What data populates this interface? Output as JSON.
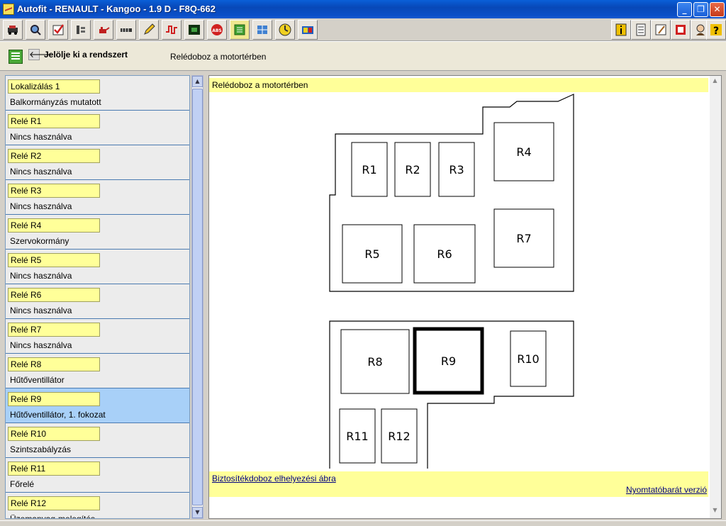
{
  "window": {
    "title": "Autofit - RENAULT - Kangoo - 1.9 D - F8Q-662",
    "controls": [
      "minimize",
      "restore",
      "close"
    ]
  },
  "toolbar": {
    "left_icons": [
      "vehicle-icon",
      "inspect-icon",
      "checklist-icon",
      "tools-icon",
      "oil-can-icon",
      "gauge-strip-icon",
      "pencil-icon",
      "signal-icon",
      "circuit-board-icon",
      "abs-icon",
      "relay-box-icon",
      "diagram-icon",
      "timer-icon",
      "battery-icon"
    ],
    "right_icons": [
      "info-icon",
      "document-icon",
      "notepad-icon",
      "warning-icon",
      "user-icon",
      "help-icon"
    ],
    "abs_label": "ABS"
  },
  "navbar": {
    "back_label": "Jelölje ki a rendszert",
    "crumb": "Relédoboz a motortérben"
  },
  "sidebar": {
    "items": [
      {
        "label": "Lokalizálás 1",
        "desc": "Balkormányzás mutatott"
      },
      {
        "label": "Relé R1",
        "desc": "Nincs használva"
      },
      {
        "label": "Relé R2",
        "desc": "Nincs használva"
      },
      {
        "label": "Relé R3",
        "desc": "Nincs használva"
      },
      {
        "label": "Relé R4",
        "desc": "Szervokormány"
      },
      {
        "label": "Relé R5",
        "desc": "Nincs használva"
      },
      {
        "label": "Relé R6",
        "desc": "Nincs használva"
      },
      {
        "label": "Relé R7",
        "desc": "Nincs használva"
      },
      {
        "label": "Relé R8",
        "desc": "Hűtőventillátor"
      },
      {
        "label": "Relé R9",
        "desc": "Hűtőventillátor, 1. fokozat"
      },
      {
        "label": "Relé R10",
        "desc": "Szintszabályzás"
      },
      {
        "label": "Relé R11",
        "desc": "Főrelé"
      },
      {
        "label": "Relé R12",
        "desc": "Üzemanyag-melegítés"
      }
    ],
    "selected_index": 9
  },
  "main": {
    "header": "Relédoboz a motortérben",
    "relays": [
      "R1",
      "R2",
      "R3",
      "R4",
      "R5",
      "R6",
      "R7",
      "R8",
      "R9",
      "R10",
      "R11",
      "R12"
    ],
    "highlighted_relay": "R9",
    "footer_link": "Biztosítékdoboz elhelyezési ábra",
    "print_link": "Nyomtatóbarát verzió"
  },
  "colors": {
    "highlight_yellow": "#ffff99",
    "selected_row": "#a8d0f8",
    "titlebar_blue": "#0a5fd8"
  }
}
